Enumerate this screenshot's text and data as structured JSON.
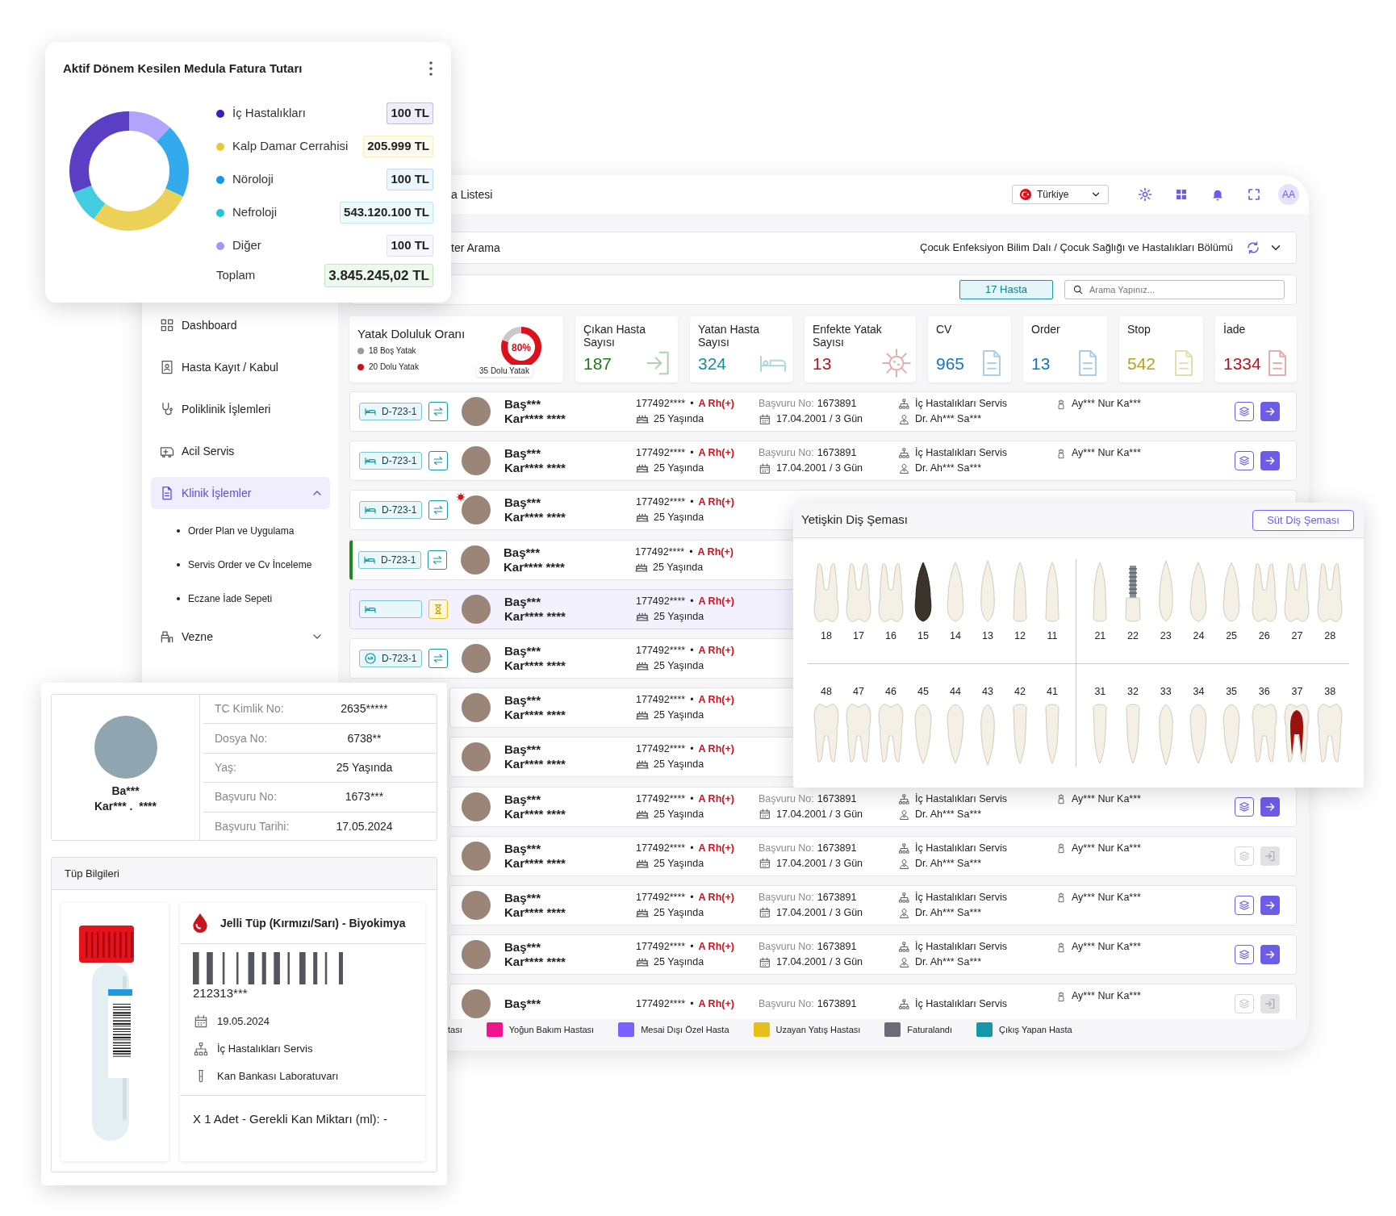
{
  "billing_card": {
    "title": "Aktif Dönem Kesilen Medula Fatura Tutarı",
    "items": [
      {
        "label": "İç Hastalıkları",
        "amount": "100 TL",
        "color": "#3d1dbb"
      },
      {
        "label": "Kalp Damar Cerrahisi",
        "amount": "205.999 TL",
        "color": "#e8c93a"
      },
      {
        "label": "Nöroloji",
        "amount": "100 TL",
        "color": "#0f9be8"
      },
      {
        "label": "Nefroloji",
        "amount": "543.120.100 TL",
        "color": "#22c4dc"
      },
      {
        "label": "Diğer",
        "amount": "100 TL",
        "color": "#a594f9"
      }
    ],
    "total_label": "Toplam",
    "total": "3.845.245,02 TL"
  },
  "header": {
    "title": "a Listesi",
    "country": "Türkiye",
    "user_initials": "AA"
  },
  "filter_bar": {
    "title": "ter Arama",
    "department": "Çocuk Enfeksiyon Bilim Dalı / Çocuk Sağlığı ve Hastalıkları Bölümü"
  },
  "toolbar": {
    "patient_count": "17 Hasta",
    "search": {
      "placeholder": "Arama Yapınız..."
    }
  },
  "sidebar": {
    "items": [
      {
        "label": "Dashboard",
        "selected": false
      },
      {
        "label": "Hasta Kayıt / Kabul",
        "selected": false
      },
      {
        "label": "Poliklinik İşlemleri",
        "selected": false
      },
      {
        "label": "Acil Servis",
        "selected": false
      },
      {
        "label": "Klinik İşlemler",
        "selected": true,
        "expanded": true,
        "children": [
          {
            "label": "Order Plan ve Uygulama"
          },
          {
            "label": "Servis Order ve Cv İnceleme"
          },
          {
            "label": "Eczane İade Sepeti"
          }
        ]
      },
      {
        "label": "Vezne",
        "selected": false,
        "expanded": false
      }
    ]
  },
  "occupancy": {
    "title": "Yatak Doluluk Oranı",
    "legend": [
      {
        "label": "18 Boş Yatak",
        "color": "#9a9aa2"
      },
      {
        "label": "20 Dolu Yatak",
        "color": "#d0101a"
      }
    ],
    "percent": "80%",
    "level": 0.8,
    "caption": "35 Dolu Yatak"
  },
  "stats": [
    {
      "title": "Çıkan Hasta Sayısı",
      "value": "187",
      "color": "#1b7a1b"
    },
    {
      "title": "Yatan Hasta Sayısı",
      "value": "324",
      "color": "#16919b"
    },
    {
      "title": "Enfekte Yatak Sayısı",
      "value": "13",
      "color": "#c0121a"
    },
    {
      "title": "CV",
      "value": "965",
      "color": "#1476c0"
    },
    {
      "title": "Order",
      "value": "13",
      "color": "#1476c0"
    },
    {
      "title": "Stop",
      "value": "542",
      "color": "#b5a11a"
    },
    {
      "title": "İade",
      "value": "1334",
      "color": "#c0121a"
    }
  ],
  "rows": [
    {
      "bed_chip": {
        "label": "D-723-1",
        "kind": "bed"
      },
      "status_button": {
        "kind": "transfer"
      },
      "infected": false,
      "flagged": false,
      "selected": false,
      "name_first": "Baş***",
      "name_last": "Kar**** ****",
      "tc": "177492****",
      "dot": "•",
      "blood": "A Rh(+)",
      "age": "25 Yaşında",
      "application_label": "Başvuru No:",
      "application_no": "1673891",
      "date": "17.04.2001 / 3 Gün",
      "service": "İç Hastalıkları Servis",
      "doctor": "Dr. Ah*** Sa***",
      "nurse": "Ay*** Nur Ka***",
      "actions_enabled": true
    },
    {
      "bed_chip": {
        "label": "D-723-1",
        "kind": "bed"
      },
      "status_button": {
        "kind": "transfer"
      },
      "infected": false,
      "flagged": false,
      "selected": false,
      "name_first": "Baş***",
      "name_last": "Kar**** ****",
      "tc": "177492****",
      "dot": "•",
      "blood": "A Rh(+)",
      "age": "25 Yaşında",
      "application_label": "Başvuru No:",
      "application_no": "1673891",
      "date": "17.04.2001 / 3 Gün",
      "service": "İç Hastalıkları Servis",
      "doctor": "Dr. Ah*** Sa***",
      "nurse": "Ay*** Nur Ka***",
      "actions_enabled": true
    },
    {
      "bed_chip": {
        "label": "D-723-1",
        "kind": "bed"
      },
      "status_button": {
        "kind": "transfer"
      },
      "infected": true,
      "flagged": false,
      "selected": false,
      "name_first": "Baş***",
      "name_last": "Kar**** ****",
      "tc": "177492****",
      "dot": "•",
      "blood": "A Rh(+)",
      "age": "25 Yaşında"
    },
    {
      "bed_chip": {
        "label": "D-723-1",
        "kind": "bed"
      },
      "status_button": {
        "kind": "transfer"
      },
      "infected": false,
      "flagged": true,
      "selected": false,
      "name_first": "Baş***",
      "name_last": "Kar**** ****",
      "tc": "177492****",
      "dot": "•",
      "blood": "A Rh(+)",
      "age": "25 Yaşında"
    },
    {
      "bed_chip": {
        "kind": "bed"
      },
      "status_button": {
        "kind": "waiting"
      },
      "infected": false,
      "flagged": false,
      "selected": true,
      "name_first": "Baş***",
      "name_last": "Kar**** ****",
      "tc": "177492****",
      "dot": "•",
      "blood": "A Rh(+)",
      "age": "25 Yaşında"
    },
    {
      "bed_chip": {
        "label": "D-723-1",
        "kind": "badge"
      },
      "status_button": {
        "kind": "transfer"
      },
      "infected": false,
      "flagged": false,
      "selected": false,
      "name_first": "Baş***",
      "name_last": "Kar**** ****",
      "tc": "177492****",
      "dot": "•",
      "blood": "A Rh(+)",
      "age": "25 Yaşında"
    },
    {
      "infected": false,
      "flagged": false,
      "selected": false,
      "name_first": "Baş***",
      "name_last": "Kar**** ****",
      "tc": "177492****",
      "dot": "•",
      "blood": "A Rh(+)",
      "age": "25 Yaşında"
    },
    {
      "infected": false,
      "flagged": false,
      "selected": false,
      "name_first": "Baş***",
      "name_last": "Kar**** ****",
      "tc": "177492****",
      "dot": "•",
      "blood": "A Rh(+)",
      "age": "25 Yaşında"
    },
    {
      "infected": false,
      "flagged": false,
      "selected": false,
      "name_first": "Baş***",
      "name_last": "Kar**** ****",
      "tc": "177492****",
      "dot": "•",
      "blood": "A Rh(+)",
      "age": "25 Yaşında",
      "application_label": "Başvuru No:",
      "application_no": "1673891",
      "date": "17.04.2001 / 3 Gün",
      "service": "İç Hastalıkları Servis",
      "doctor": "Dr. Ah*** Sa***",
      "nurse": "Ay*** Nur Ka***",
      "actions_enabled": true
    },
    {
      "infected": false,
      "flagged": false,
      "selected": false,
      "name_first": "Baş***",
      "name_last": "Kar**** ****",
      "tc": "177492****",
      "dot": "•",
      "blood": "A Rh(+)",
      "age": "25 Yaşında",
      "application_label": "Başvuru No:",
      "application_no": "1673891",
      "date": "17.04.2001 / 3 Gün",
      "service": "İç Hastalıkları Servis",
      "doctor": "Dr. Ah*** Sa***",
      "nurse": "Ay*** Nur Ka***",
      "actions_enabled": false
    },
    {
      "infected": false,
      "flagged": false,
      "selected": false,
      "name_first": "Baş***",
      "name_last": "Kar**** ****",
      "tc": "177492****",
      "dot": "•",
      "blood": "A Rh(+)",
      "age": "25 Yaşında",
      "application_label": "Başvuru No:",
      "application_no": "1673891",
      "date": "17.04.2001 / 3 Gün",
      "service": "İç Hastalıkları Servis",
      "doctor": "Dr. Ah*** Sa***",
      "nurse": "Ay*** Nur Ka***",
      "actions_enabled": true
    },
    {
      "infected": false,
      "flagged": false,
      "selected": false,
      "name_first": "Baş***",
      "name_last": "Kar**** ****",
      "tc": "177492****",
      "dot": "•",
      "blood": "A Rh(+)",
      "age": "25 Yaşında",
      "application_label": "Başvuru No:",
      "application_no": "1673891",
      "date": "17.04.2001 / 3 Gün",
      "service": "İç Hastalıkları Servis",
      "doctor": "Dr. Ah*** Sa***",
      "nurse": "Ay*** Nur Ka***",
      "actions_enabled": true
    },
    {
      "infected": false,
      "flagged": false,
      "selected": false,
      "name_first": "Baş***",
      "tc": "177492****",
      "dot": "•",
      "blood": "A Rh(+)",
      "application_label": "Başvuru No:",
      "application_no": "1673891",
      "service": "İç Hastalıkları Servis",
      "nurse": "Ay*** Nur Ka***",
      "actions_enabled": false
    }
  ],
  "legend": [
    {
      "label": "tası"
    },
    {
      "label": "Yoğun Bakım Hastası",
      "color": "#f0148c"
    },
    {
      "label": "Mesai Dışı Özel Hasta",
      "color": "#7b61ff"
    },
    {
      "label": "Uzayan Yatış Hastası",
      "color": "#e5c01a"
    },
    {
      "label": "Faturalandı",
      "color": "#6c6c78"
    },
    {
      "label": "Çıkış Yapan Hasta",
      "color": "#1597a8"
    }
  ],
  "dental_chart": {
    "title": "Yetişkin Diş Şeması",
    "button": "Süt Diş Şeması",
    "upper": [
      {
        "number": "18",
        "kind": "healthy"
      },
      {
        "number": "17",
        "kind": "healthy"
      },
      {
        "number": "16",
        "kind": "healthy"
      },
      {
        "number": "15",
        "kind": "decayed"
      },
      {
        "number": "14",
        "kind": "healthy"
      },
      {
        "number": "13",
        "kind": "healthy"
      },
      {
        "number": "12",
        "kind": "healthy"
      },
      {
        "number": "11",
        "kind": "healthy"
      },
      {
        "number": "21",
        "kind": "healthy"
      },
      {
        "number": "22",
        "kind": "implant"
      },
      {
        "number": "23",
        "kind": "healthy"
      },
      {
        "number": "24",
        "kind": "healthy"
      },
      {
        "number": "25",
        "kind": "healthy"
      },
      {
        "number": "26",
        "kind": "healthy"
      },
      {
        "number": "27",
        "kind": "healthy"
      },
      {
        "number": "28",
        "kind": "healthy"
      }
    ],
    "lower": [
      {
        "number": "48",
        "kind": "healthy"
      },
      {
        "number": "47",
        "kind": "healthy"
      },
      {
        "number": "46",
        "kind": "healthy"
      },
      {
        "number": "45",
        "kind": "healthy"
      },
      {
        "number": "44",
        "kind": "healthy"
      },
      {
        "number": "43",
        "kind": "healthy"
      },
      {
        "number": "42",
        "kind": "healthy"
      },
      {
        "number": "41",
        "kind": "healthy"
      },
      {
        "number": "31",
        "kind": "healthy"
      },
      {
        "number": "32",
        "kind": "healthy"
      },
      {
        "number": "33",
        "kind": "healthy"
      },
      {
        "number": "34",
        "kind": "healthy"
      },
      {
        "number": "35",
        "kind": "healthy"
      },
      {
        "number": "36",
        "kind": "healthy"
      },
      {
        "number": "37",
        "kind": "root_canal"
      },
      {
        "number": "38",
        "kind": "healthy"
      }
    ]
  },
  "patient_card": {
    "name_first": "Ba***",
    "name_last": "Kar*** .  ****",
    "fields": [
      {
        "label": "TC Kimlik No:",
        "value": "2635*****"
      },
      {
        "label": "Dosya No:",
        "value": "6738**"
      },
      {
        "label": "Yaş:",
        "value": "25 Yaşında"
      },
      {
        "label": "Başvuru No:",
        "value": "1673***"
      },
      {
        "label": "Başvuru Tarihi:",
        "value": "17.05.2024"
      }
    ],
    "tube_section": {
      "title": "Tüp Bilgileri",
      "tube_name": "Jelli Tüp (Kırmızı/Sarı) - Biyokimya",
      "barcode": "212313***",
      "date": "19.05.2024",
      "service": "İç Hastalıkları Servis",
      "lab": "Kan Bankası Laboratuvarı",
      "footer": "X 1 Adet - Gerekli Kan Miktarı (ml): -"
    }
  }
}
